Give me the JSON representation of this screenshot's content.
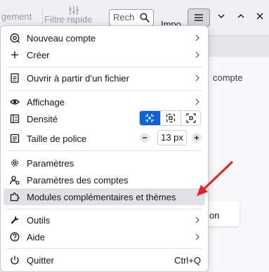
{
  "toolbar": {
    "ghost_left": "gement",
    "ghost_filter": "Filtre rapide",
    "search_value": "Rech",
    "import_label": "Impo"
  },
  "background": {
    "ghost_compte": "compte",
    "card_text": "on"
  },
  "menu": {
    "items": [
      {
        "label": "Nouveau compte",
        "icon": "new-account-icon",
        "submenu": true
      },
      {
        "label": "Créer",
        "icon": "plus-icon",
        "submenu": true
      },
      {
        "label": "Ouvrir à partir d’un fichier",
        "icon": "open-file-icon",
        "submenu": true
      },
      {
        "label": "Affichage",
        "icon": "eye-icon",
        "submenu": true
      },
      {
        "label": "Densité",
        "icon": "density-icon",
        "submenu": false
      },
      {
        "label": "Taille de police",
        "icon": "font-size-icon",
        "submenu": false
      },
      {
        "label": "Paramètres",
        "icon": "settings-gear-icon",
        "submenu": false
      },
      {
        "label": "Paramètres des comptes",
        "icon": "account-settings-icon",
        "submenu": false
      },
      {
        "label": "Modules complémentaires et thèmes",
        "icon": "puzzle-icon",
        "submenu": false,
        "highlighted": true
      },
      {
        "label": "Outils",
        "icon": "wrench-icon",
        "submenu": true
      },
      {
        "label": "Aide",
        "icon": "help-icon",
        "submenu": true
      },
      {
        "label": "Quitter",
        "icon": "quit-icon",
        "submenu": false,
        "shortcut": "Ctrl+Q"
      }
    ],
    "density_selected": 0,
    "font_size_value": "13 px"
  },
  "colors": {
    "accent": "#0a63d6",
    "highlight": "#e0e0e6",
    "annotation_arrow": "#e0262b"
  }
}
